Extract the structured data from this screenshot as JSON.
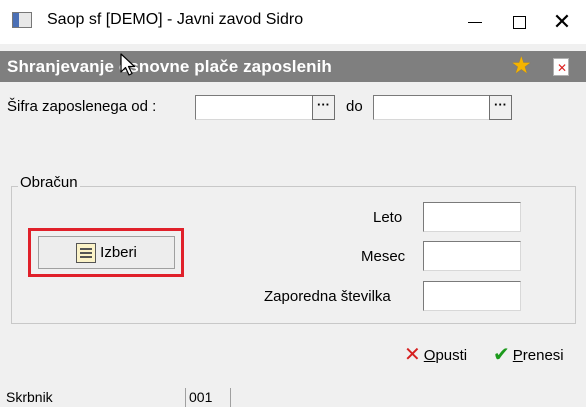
{
  "window": {
    "title": "Saop sf [DEMO] - Javni zavod Sidro",
    "minimize_glyph": "",
    "close_glyph": "✕"
  },
  "form": {
    "title": "Shranjevanje osnovne plače zaposlenih"
  },
  "employee_code": {
    "label_from": "Šifra zaposlenega od :",
    "value_from": "",
    "label_to": "do",
    "value_to": "",
    "browse_label": "···"
  },
  "group": {
    "legend": "Obračun",
    "select_button": "Izberi",
    "fields": {
      "leto_label": "Leto",
      "leto_value": "",
      "mesec_label": "Mesec",
      "mesec_value": "",
      "zaporedna_label": "Zaporedna številka",
      "zaporedna_value": ""
    }
  },
  "actions": {
    "cancel_first": "O",
    "cancel_rest": "pusti",
    "transfer_first": "P",
    "transfer_rest": "renesi"
  },
  "status": {
    "user": "Skrbnik",
    "code": "001"
  },
  "colors": {
    "header_bg": "#7f7f7f",
    "highlight": "#e0202a",
    "star": "#f5b400"
  },
  "icons": [
    "app-icon",
    "star-icon",
    "exit-icon",
    "select-icon",
    "cancel-icon",
    "confirm-icon",
    "cursor-icon"
  ]
}
